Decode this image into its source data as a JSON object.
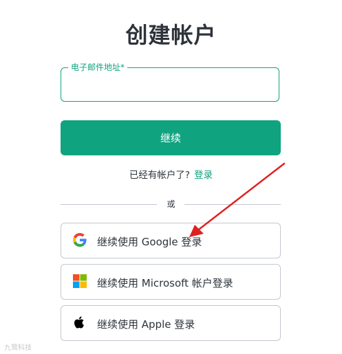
{
  "page": {
    "title": "创建帐户"
  },
  "email": {
    "label": "电子邮件地址*",
    "value": ""
  },
  "continue_button": "继续",
  "login_prompt": {
    "text": "已经有帐户了?",
    "link": "登录"
  },
  "divider": "或",
  "social": [
    {
      "label": "继续使用 Google 登录",
      "icon": "google-icon"
    },
    {
      "label": "继续使用 Microsoft 帐户登录",
      "icon": "microsoft-icon"
    },
    {
      "label": "继续使用 Apple 登录",
      "icon": "apple-icon"
    }
  ],
  "colors": {
    "accent": "#10a37f",
    "annotation_arrow": "#e02020"
  },
  "watermark": "九鹭科技"
}
